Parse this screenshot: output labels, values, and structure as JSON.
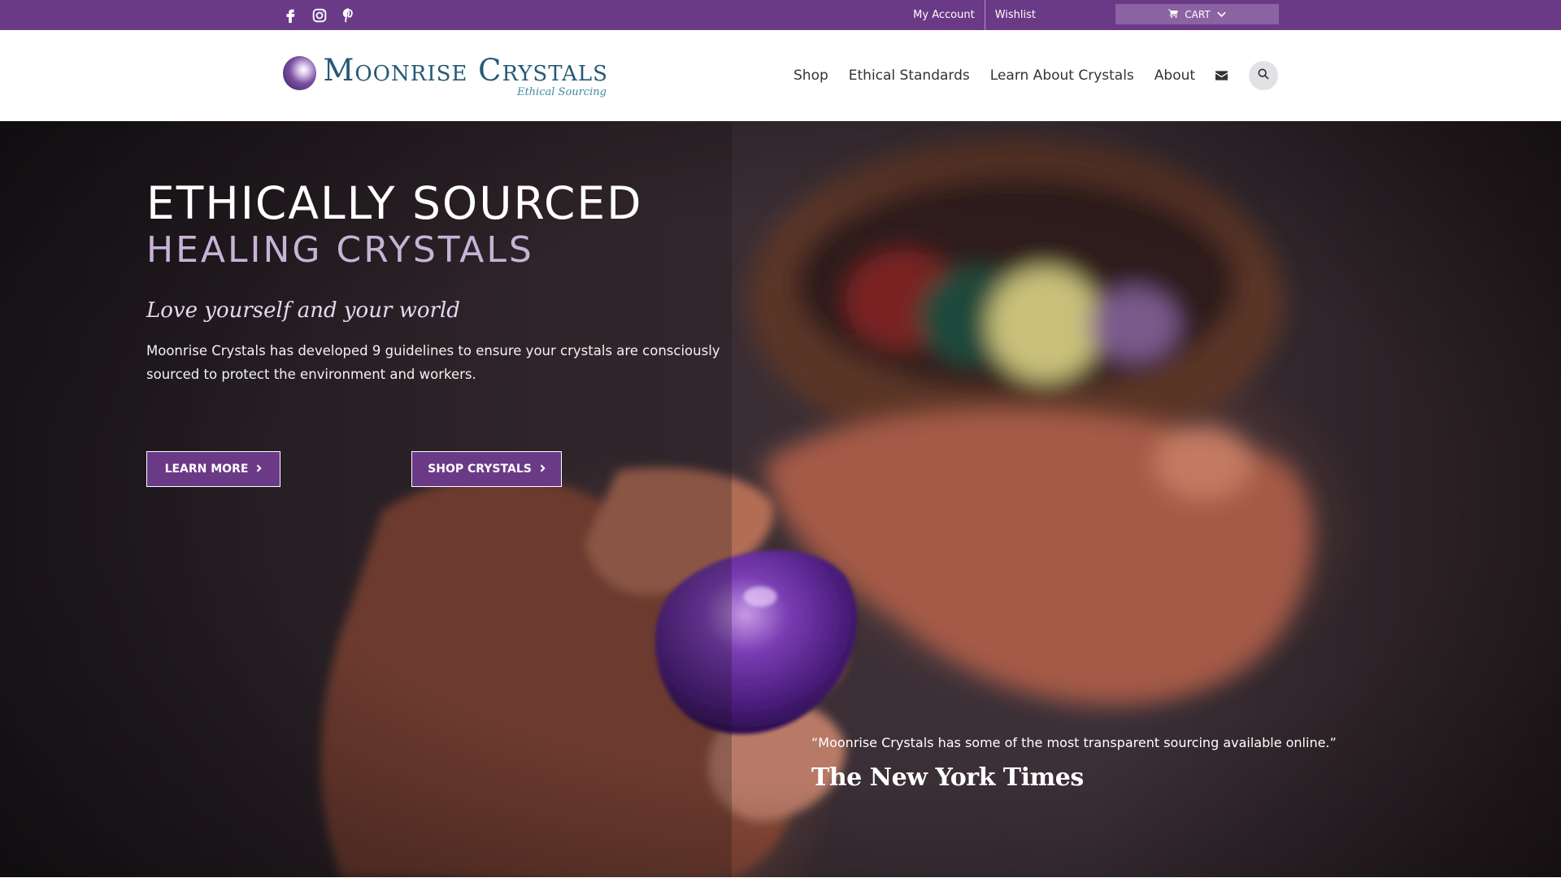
{
  "topbar": {
    "social_icons": [
      "facebook-icon",
      "instagram-icon",
      "pinterest-icon"
    ],
    "links": {
      "my_account": "My Account",
      "wishlist": "Wishlist"
    },
    "cart_label": "CART",
    "colors": {
      "background": "#6b3a87",
      "cart_background": "#8b63a3"
    }
  },
  "header": {
    "logo": {
      "name": "Moonrise Crystals",
      "tagline": "Ethical Sourcing"
    },
    "nav": {
      "shop": "Shop",
      "ethical": "Ethical Standards",
      "learn": "Learn About Crystals",
      "about": "About"
    },
    "icons": [
      "envelope-icon",
      "search-icon"
    ]
  },
  "hero": {
    "title_line1": "ETHICALLY SOURCED",
    "title_line2": "HEALING CRYSTALS",
    "script_text": "Love yourself and your world",
    "description": "Moonrise Crystals has developed 9 guidelines to ensure your crystals are consciously sourced to protect the environment and workers.",
    "buttons": {
      "learn_more": "LEARN MORE",
      "shop_crystals": "SHOP CRYSTALS"
    },
    "quote": "“Moonrise Crystals has some of the most transparent sourcing available online.”",
    "quote_source": "The New York Times",
    "colors": {
      "accent": "#6b3a87",
      "title_secondary": "#c7b3d6"
    }
  }
}
